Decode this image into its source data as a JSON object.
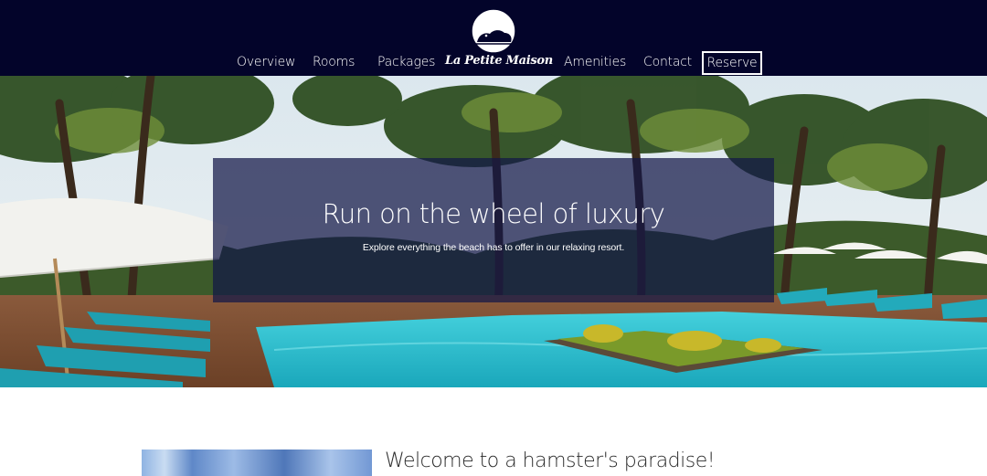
{
  "brand": {
    "name": "La Petite Maison"
  },
  "nav": {
    "items": [
      {
        "label": "Overview"
      },
      {
        "label": "Rooms"
      },
      {
        "label": "Packages"
      },
      {
        "label": "Amenities"
      },
      {
        "label": "Contact"
      }
    ],
    "reserve_label": "Reserve"
  },
  "hero": {
    "title": "Run on the wheel of luxury",
    "subtitle": "Explore everything the beach has to offer in our relaxing resort."
  },
  "welcome": {
    "title": "Welcome to a hamster's paradise!"
  },
  "colors": {
    "header_bg": "#03042a",
    "hero_overlay": "#121646",
    "pool": "#2fc0cf",
    "lounger": "#1f9fb0"
  }
}
